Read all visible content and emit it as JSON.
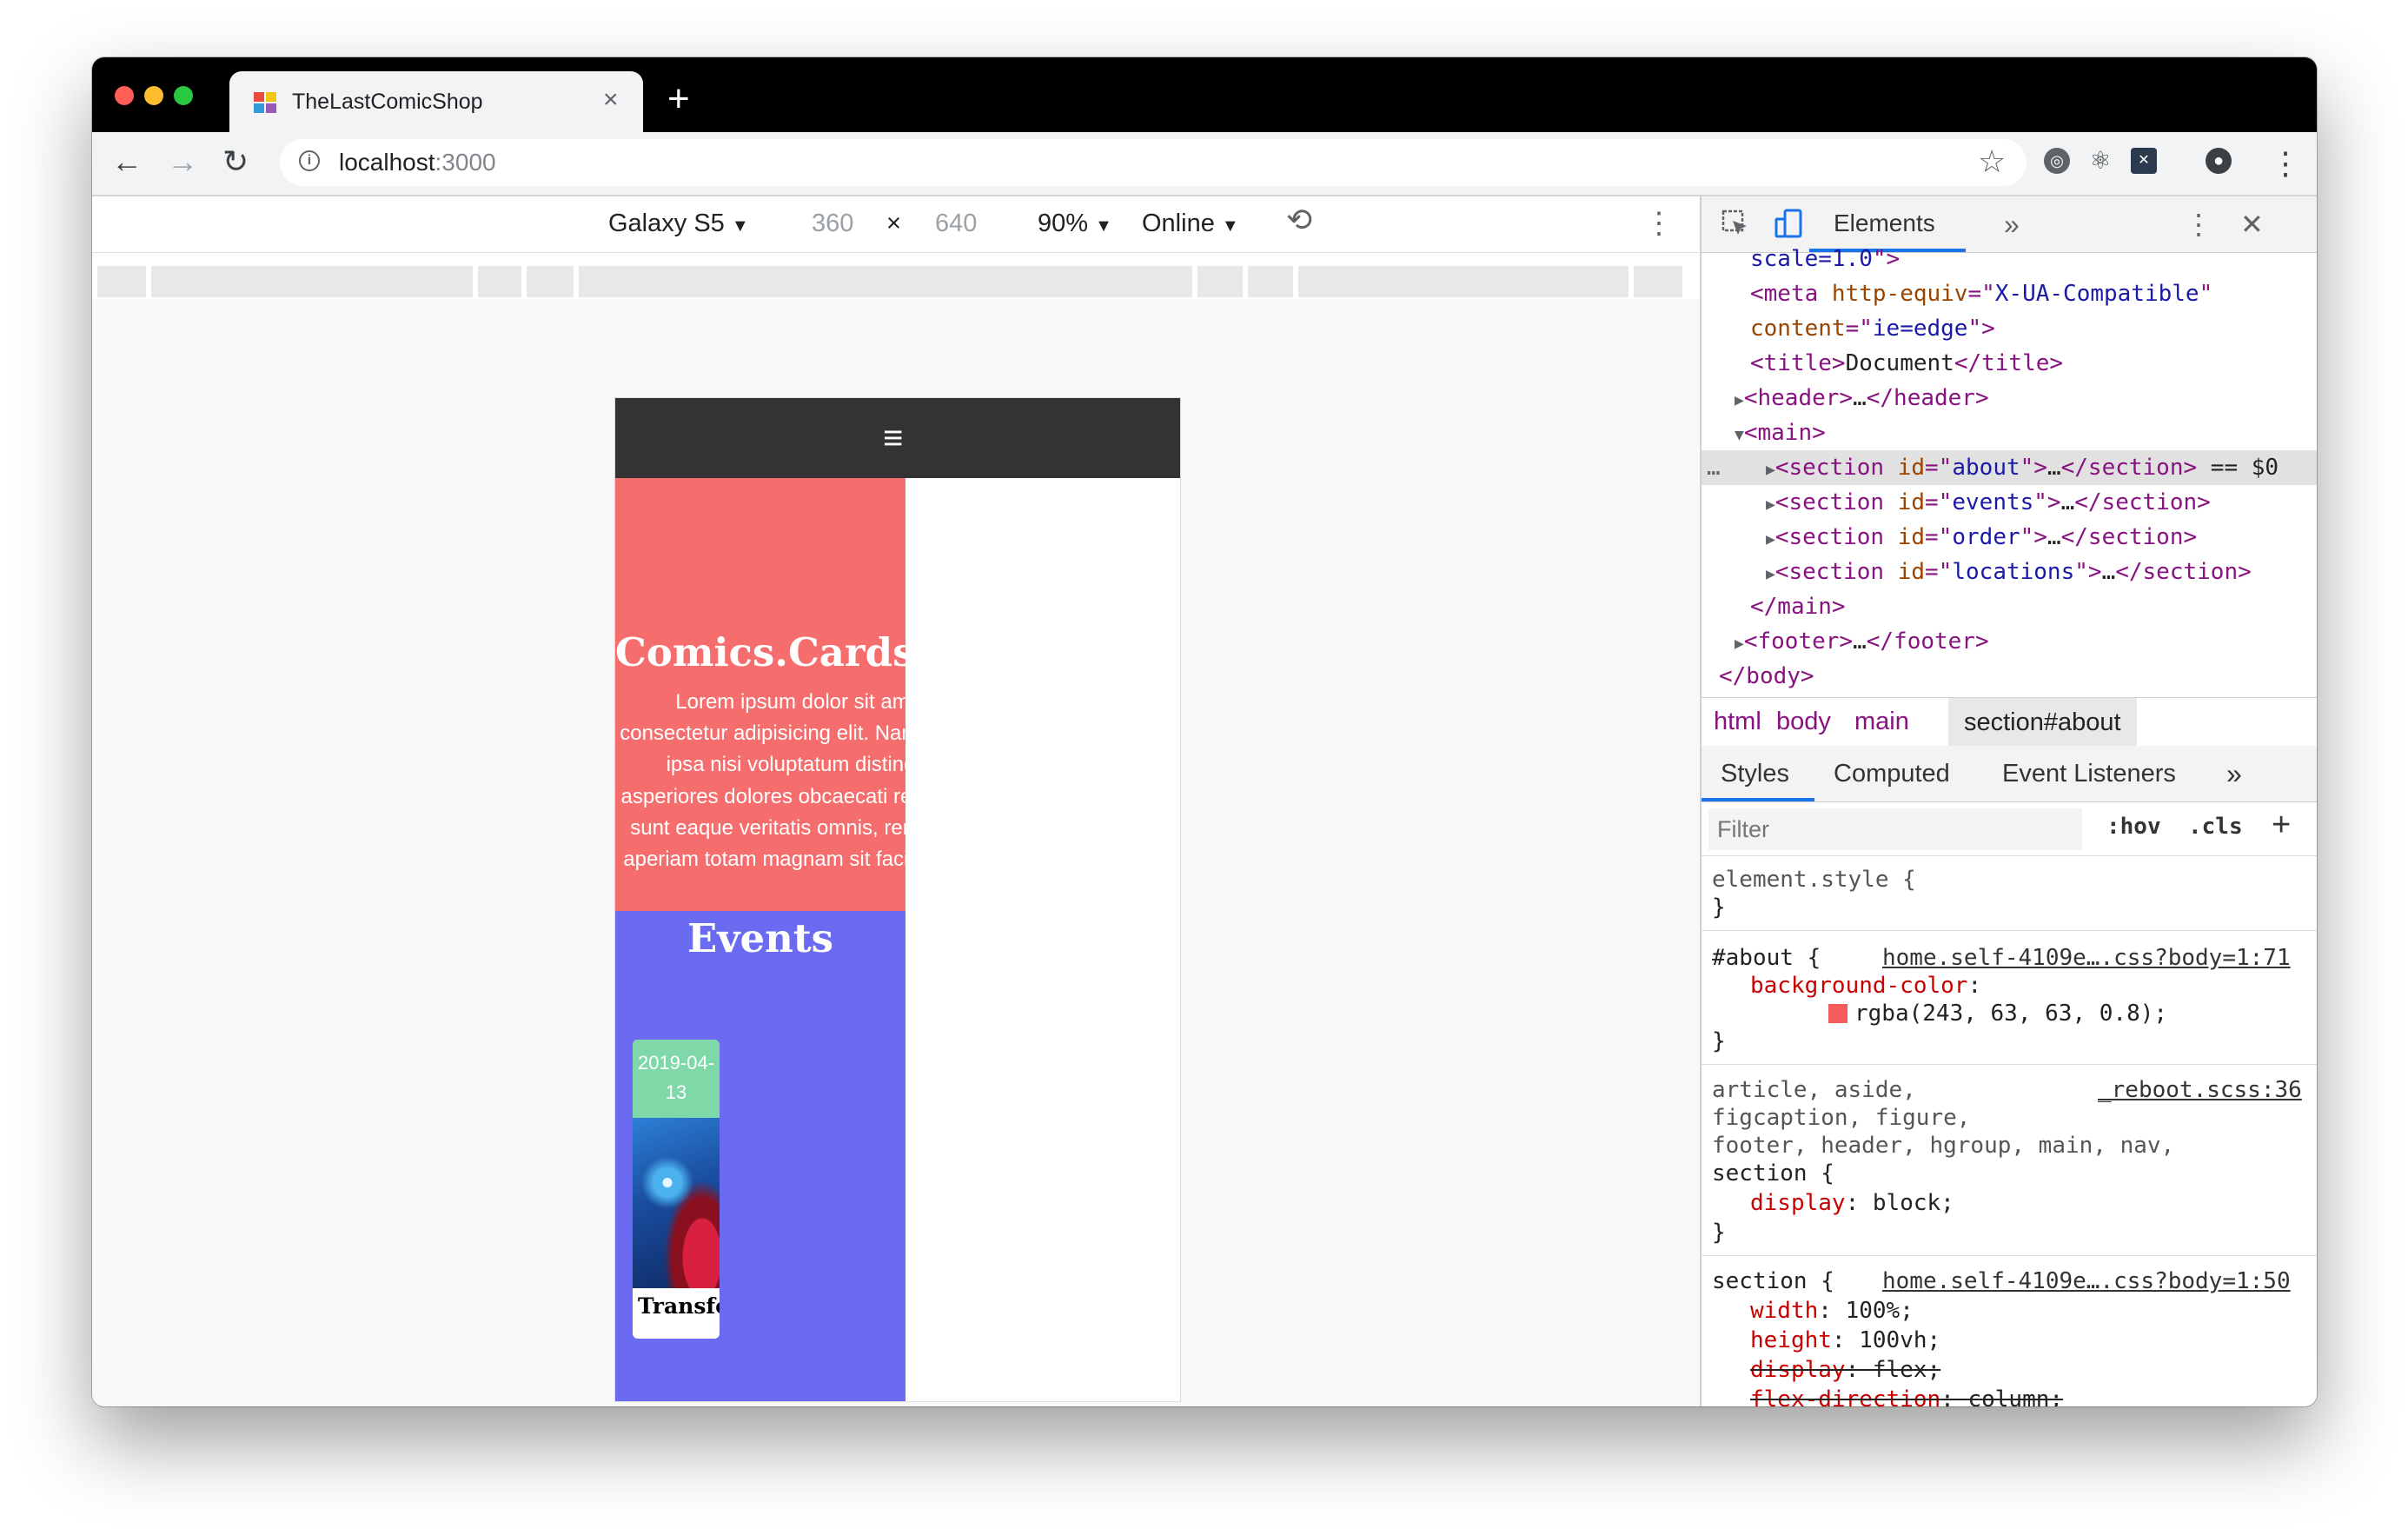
{
  "browser": {
    "tab_title": "TheLastComicShop",
    "tab_close": "×",
    "new_tab": "+",
    "url_host": "localhost",
    "url_port": ":3000",
    "back": "←",
    "forward": "→",
    "reload": "↻",
    "star": "☆",
    "menu": "⋮",
    "colors": {
      "tab_bg": "#f1f3f4",
      "close": "#ff5f57",
      "minimize": "#febc2e",
      "zoom": "#28c840"
    }
  },
  "device_toolbar": {
    "device": "Galaxy S5",
    "width": "360",
    "times": "×",
    "height": "640",
    "zoom": "90%",
    "network": "Online",
    "caret": "▼",
    "rotate": "⟲",
    "more": "⋮"
  },
  "site": {
    "menu_icon": "≡",
    "about_title": "Comics.Cards.Fi",
    "about_text": "Lorem ipsum dolor sit amet consectetur adipisicing elit. Nam neque ipsa nisi voluptatum distinctio asperiores dolores obcaecati reiciendis sunt eaque veritatis omnis, rerum qui aperiam totam magnam sit facilis quos",
    "events_title": "Events",
    "event_date": "2019-04-13",
    "event_title": "Transformers TCG",
    "colors": {
      "header": "#333333",
      "about": "rgba(243,63,63,0.8)",
      "events": "#6a6bf0",
      "date": "#7ed8a8"
    }
  },
  "devtools": {
    "tab_elements": "Elements",
    "more_tabs": "»",
    "close": "✕",
    "dom_lines": [
      {
        "indent": 2,
        "parts": [
          [
            "val",
            "scale=1.0"
          ],
          [
            "tag",
            "\">"
          ]
        ]
      },
      {
        "indent": 2,
        "parts": [
          [
            "tag",
            "<meta "
          ],
          [
            "attr",
            "http-equiv"
          ],
          [
            "tag",
            "=\""
          ],
          [
            "val",
            "X-UA-Compatible"
          ],
          [
            "tag",
            "\""
          ]
        ]
      },
      {
        "indent": 2,
        "parts": [
          [
            "attr",
            "content"
          ],
          [
            "tag",
            "=\""
          ],
          [
            "val",
            "ie=edge"
          ],
          [
            "tag",
            "\">"
          ]
        ]
      },
      {
        "indent": 2,
        "parts": [
          [
            "tag",
            "<title>"
          ],
          [
            "txt",
            "Document"
          ],
          [
            "tag",
            "</title>"
          ]
        ]
      },
      {
        "indent": 1,
        "tri": "▶",
        "parts": [
          [
            "tag",
            "<header>"
          ],
          [
            "txt",
            "…"
          ],
          [
            "tag",
            "</header>"
          ]
        ]
      },
      {
        "indent": 1,
        "tri": "▼",
        "parts": [
          [
            "tag",
            "<main>"
          ]
        ]
      },
      {
        "indent": 3,
        "tri": "▶",
        "parts": [
          [
            "tag",
            "<section "
          ],
          [
            "attr",
            "id"
          ],
          [
            "tag",
            "=\""
          ],
          [
            "val",
            "about"
          ],
          [
            "tag",
            "\">"
          ],
          [
            "txt",
            "…"
          ],
          [
            "tag",
            "</section>"
          ],
          [
            "txt",
            " == $0"
          ]
        ]
      },
      {
        "indent": 3,
        "tri": "▶",
        "parts": [
          [
            "tag",
            "<section "
          ],
          [
            "attr",
            "id"
          ],
          [
            "tag",
            "=\""
          ],
          [
            "val",
            "events"
          ],
          [
            "tag",
            "\">"
          ],
          [
            "txt",
            "…"
          ],
          [
            "tag",
            "</section>"
          ]
        ]
      },
      {
        "indent": 3,
        "tri": "▶",
        "parts": [
          [
            "tag",
            "<section "
          ],
          [
            "attr",
            "id"
          ],
          [
            "tag",
            "=\""
          ],
          [
            "val",
            "order"
          ],
          [
            "tag",
            "\">"
          ],
          [
            "txt",
            "…"
          ],
          [
            "tag",
            "</section>"
          ]
        ]
      },
      {
        "indent": 3,
        "tri": "▶",
        "parts": [
          [
            "tag",
            "<section "
          ],
          [
            "attr",
            "id"
          ],
          [
            "tag",
            "=\""
          ],
          [
            "val",
            "locations"
          ],
          [
            "tag",
            "\">"
          ],
          [
            "txt",
            "…"
          ],
          [
            "tag",
            "</section>"
          ]
        ]
      },
      {
        "indent": 2,
        "parts": [
          [
            "tag",
            "</main>"
          ]
        ]
      },
      {
        "indent": 1,
        "tri": "▶",
        "parts": [
          [
            "tag",
            "<footer>"
          ],
          [
            "txt",
            "…"
          ],
          [
            "tag",
            "</footer>"
          ]
        ]
      },
      {
        "indent": 0,
        "parts": [
          [
            "tag",
            "</body>"
          ]
        ]
      }
    ],
    "selected_marker": "…",
    "breadcrumbs": [
      "html",
      "body",
      "main"
    ],
    "breadcrumb_active": "section#about",
    "subtabs": [
      "Styles",
      "Computed",
      "Event Listeners"
    ],
    "subtabs_more": "»",
    "filter_placeholder": "Filter",
    "hov": ":hov",
    "cls": ".cls",
    "plus": "+",
    "rules": {
      "element_style": "element.style {",
      "close_brace": "}",
      "about_selector": "#about {",
      "about_source": "home.self-4109e….css?body=1:71",
      "about_prop": "background-color",
      "about_value": "rgba(243, 63, 63, 0.8);",
      "reboot_sel1": "article, aside,",
      "reboot_source": "_reboot.scss:36",
      "reboot_sel2": "figcaption, figure,",
      "reboot_sel3": "footer, header, hgroup, main, nav,",
      "reboot_sel4": "section {",
      "display_prop": "display",
      "display_value": "block;",
      "section_selector": "section {",
      "section_source": "home.self-4109e….css?body=1:50",
      "width_prop": "width",
      "width_value": "100%;",
      "height_prop": "height",
      "height_value": "100vh;",
      "flex_prop": "display",
      "flex_value": "flex;",
      "flexdir_prop": "flex-direction",
      "flexdir_value": "column;"
    }
  }
}
